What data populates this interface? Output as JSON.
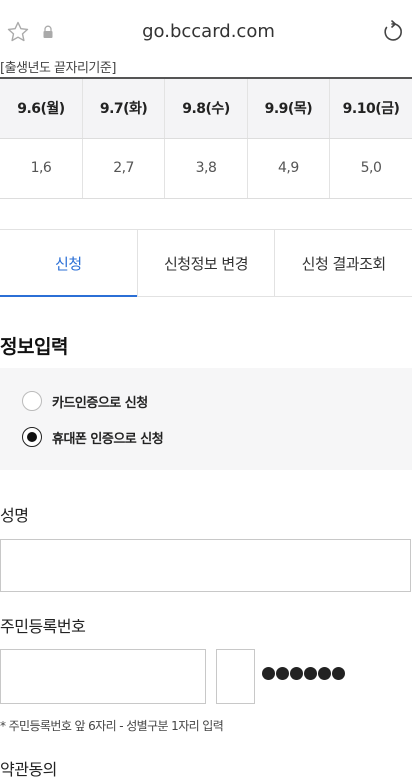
{
  "browser": {
    "url": "go.bccard.com",
    "icons": {
      "favorite": "star-outline-icon",
      "secure": "lock-icon",
      "reload": "reload-icon"
    }
  },
  "schedule": {
    "caption": "[출생년도 끝자리기준]",
    "headers": [
      "9.6(월)",
      "9.7(화)",
      "9.8(수)",
      "9.9(목)",
      "9.10(금)"
    ],
    "values": [
      "1,6",
      "2,7",
      "3,8",
      "4,9",
      "5,0"
    ]
  },
  "tabs": [
    {
      "label": "신청",
      "active": true
    },
    {
      "label": "신청정보 변경",
      "active": false
    },
    {
      "label": "신청 결과조회",
      "active": false
    }
  ],
  "form": {
    "section_title": "정보입력",
    "auth_options": [
      {
        "label": "카드인증으로 신청",
        "checked": false
      },
      {
        "label": "휴대폰 인증으로 신청",
        "checked": true
      }
    ],
    "name_label": "성명",
    "name_value": "",
    "rrn_label": "주민등록번호",
    "rrn_front_value": "",
    "rrn_gender_value": "",
    "rrn_masked_digits": 6,
    "rrn_note": "* 주민등록번호 앞 6자리 - 성별구분 1자리 입력",
    "agree_title": "약관동의"
  },
  "colors": {
    "accent": "#2b6fd6",
    "header_bg": "#f4f4f6",
    "radio_box_bg": "#f6f6f7"
  }
}
